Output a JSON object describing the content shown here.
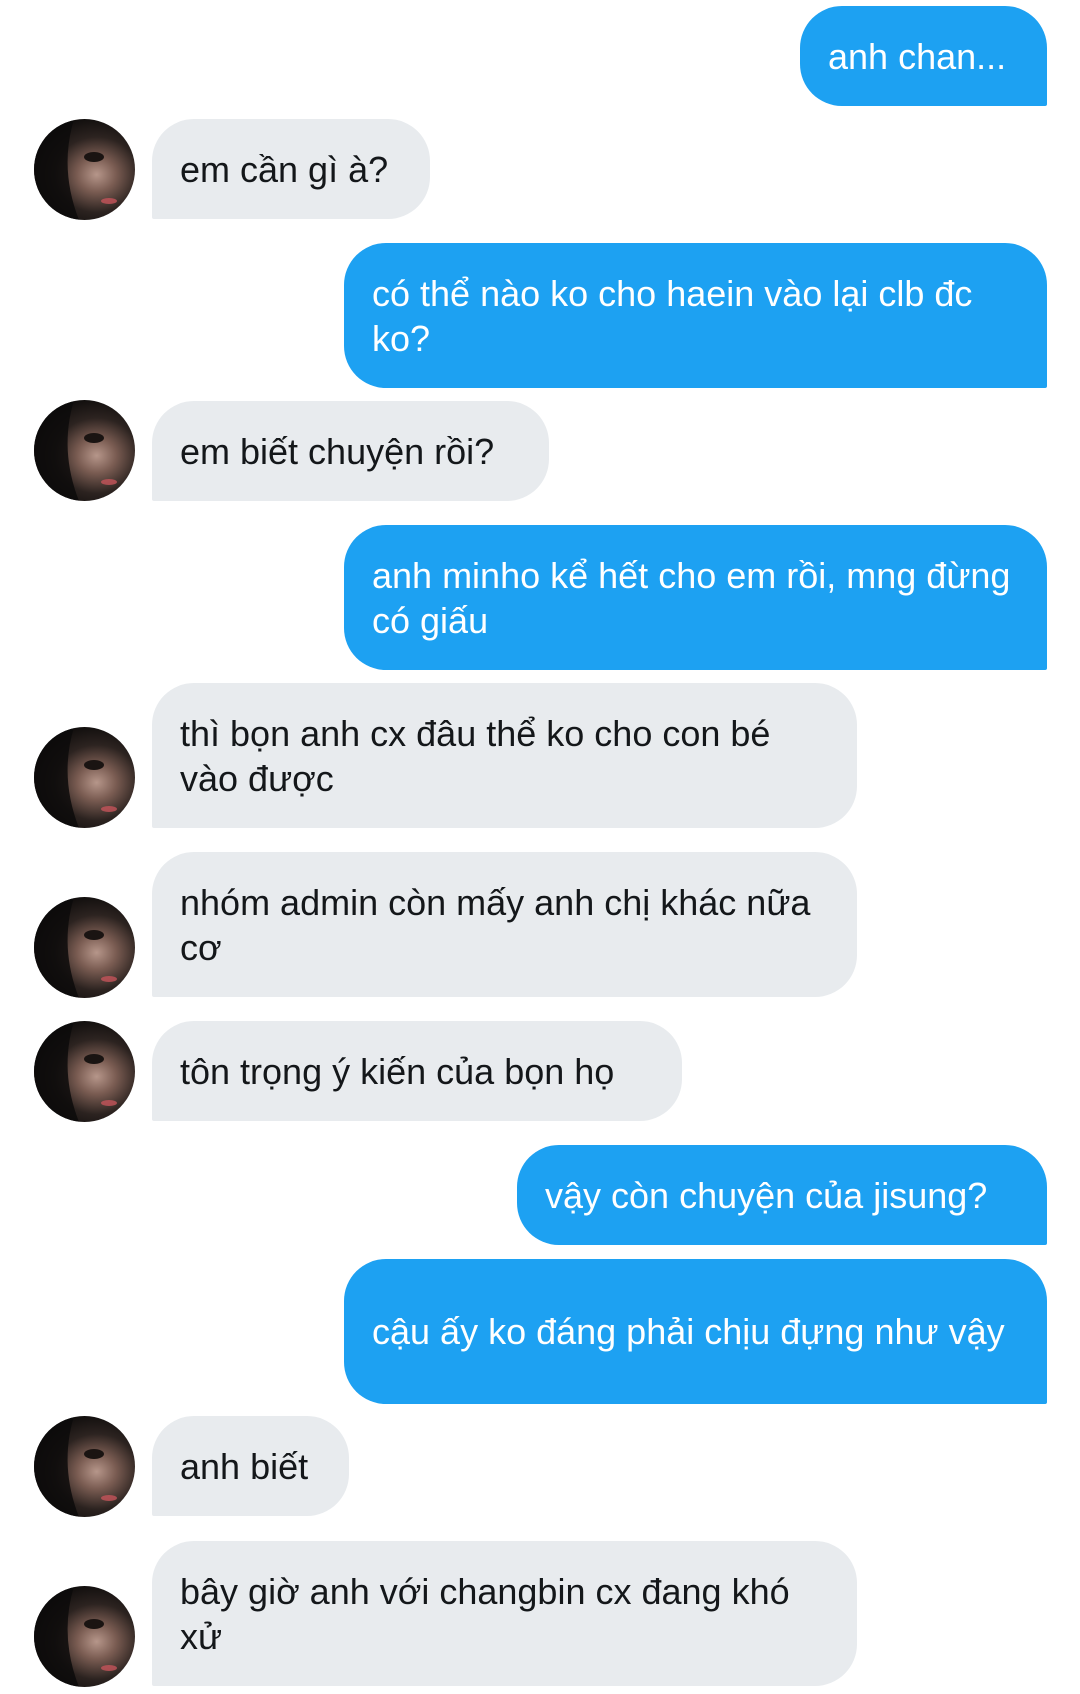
{
  "conversation": {
    "messages": [
      {
        "from": "me",
        "text": "anh chan..."
      },
      {
        "from": "them",
        "text": "em cần gì à?"
      },
      {
        "from": "me",
        "text": "có thể nào ko cho haein vào lại clb đc ko?"
      },
      {
        "from": "them",
        "text": "em biết chuyện rồi?"
      },
      {
        "from": "me",
        "text": "anh minho kể hết cho em rồi, mng đừng có giấu"
      },
      {
        "from": "them",
        "text": "thì bọn anh cx đâu thể ko cho con bé vào được"
      },
      {
        "from": "them",
        "text": "nhóm admin còn mấy anh chị khác nữa cơ"
      },
      {
        "from": "them",
        "text": "tôn trọng ý kiến của bọn họ"
      },
      {
        "from": "me",
        "text": "vậy còn chuyện của jisung?"
      },
      {
        "from": "me",
        "text": "cậu ấy ko đáng phải chịu đựng như vậy"
      },
      {
        "from": "them",
        "text": "anh biết"
      },
      {
        "from": "them",
        "text": "bây giờ anh với changbin cx đang khó xử"
      }
    ]
  },
  "colors": {
    "sent_bubble": "#1da1f2",
    "received_bubble": "#e8ebee",
    "received_text": "#14171a",
    "sent_text": "#ffffff"
  },
  "avatar_icon": "person-avatar-photo"
}
